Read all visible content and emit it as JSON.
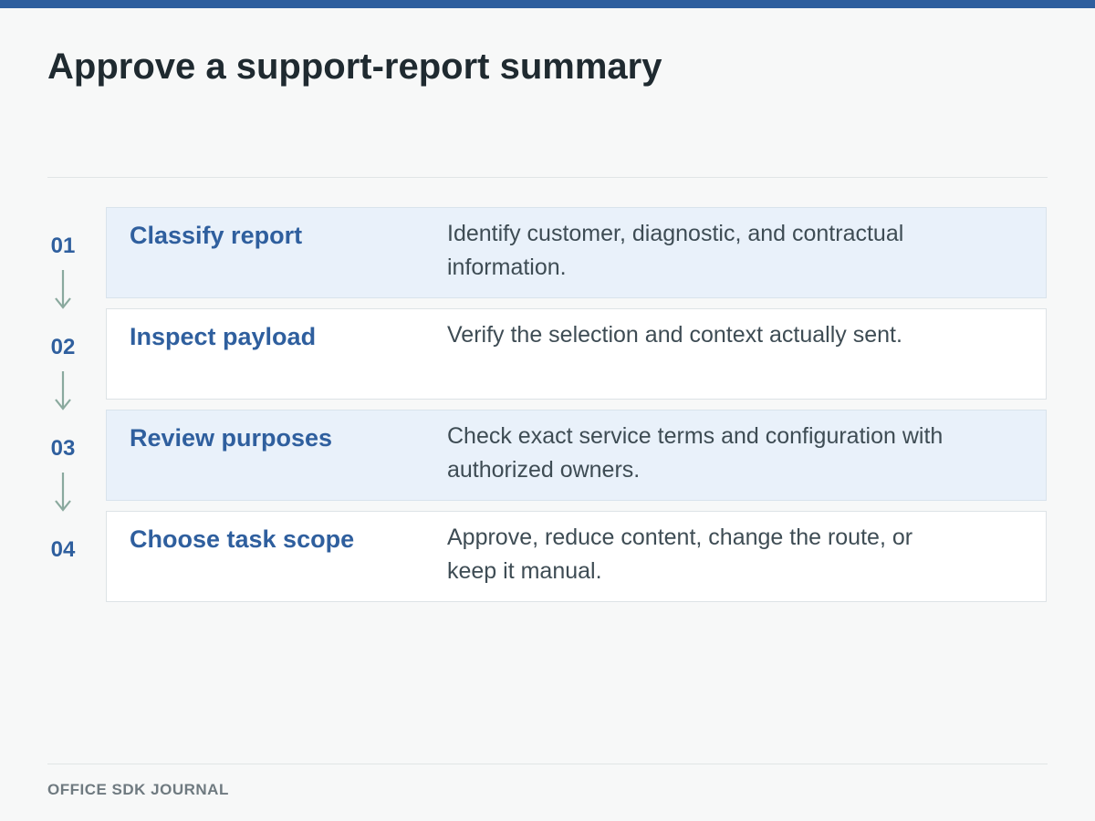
{
  "title": "Approve a support-report summary",
  "footer": "OFFICE SDK JOURNAL",
  "colors": {
    "accent": "#2f5f9e",
    "shaded_card": "#e9f1fa",
    "arrow": "#8aa99e"
  },
  "steps": [
    {
      "number": "01",
      "title": "Classify report",
      "description": "Identify customer, diagnostic, and contractual information."
    },
    {
      "number": "02",
      "title": "Inspect payload",
      "description": "Verify the selection and context actually sent."
    },
    {
      "number": "03",
      "title": "Review purposes",
      "description": "Check exact service terms and configuration with authorized owners."
    },
    {
      "number": "04",
      "title": "Choose task scope",
      "description": "Approve, reduce content, change the route, or keep it manual."
    }
  ]
}
